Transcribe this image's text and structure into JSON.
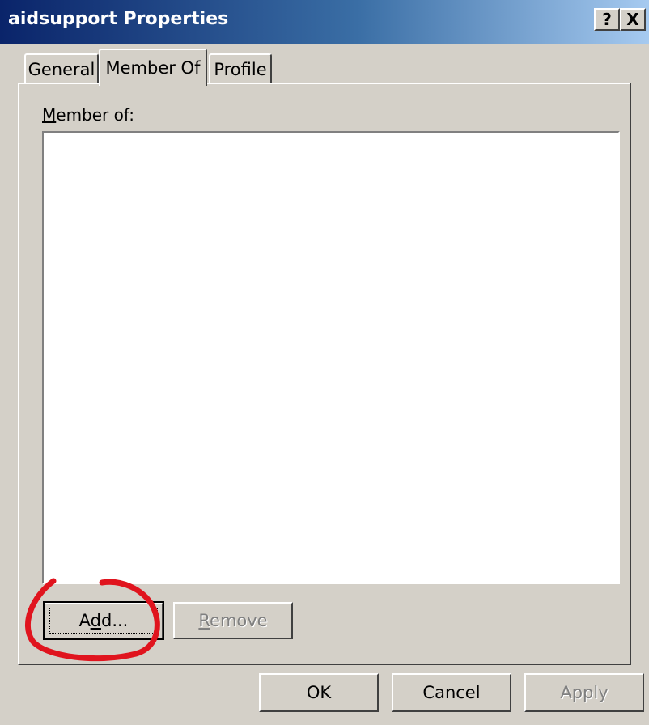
{
  "window": {
    "title": "aidsupport Properties",
    "help_button": "?",
    "close_button": "X"
  },
  "tabs": [
    {
      "label": "General",
      "selected": false
    },
    {
      "label": "Member Of",
      "selected": true
    },
    {
      "label": "Profile",
      "selected": false
    }
  ],
  "member_of": {
    "label_mnemonic": "M",
    "label_rest": "ember of:",
    "items": []
  },
  "buttons": {
    "add": {
      "pre": "A",
      "mnemonic": "d",
      "post": "d...",
      "enabled": true
    },
    "remove": {
      "mnemonic": "R",
      "post": "emove",
      "enabled": false
    },
    "ok": "OK",
    "cancel": "Cancel",
    "apply": {
      "label": "Apply",
      "enabled": false
    }
  },
  "colors": {
    "annotation_circle": "#e0141e",
    "title_bar_start": "#0a246a",
    "dialog_face": "#d4d0c8"
  }
}
